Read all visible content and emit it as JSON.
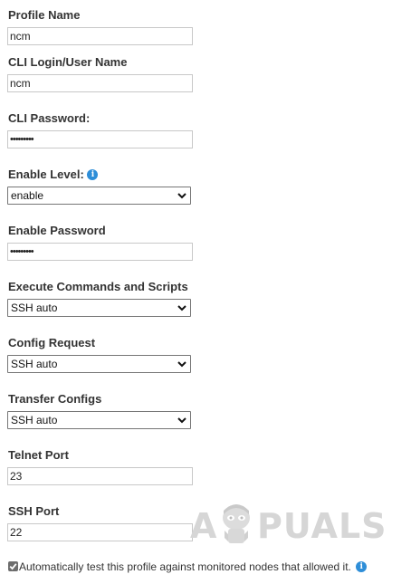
{
  "fields": {
    "profile_name": {
      "label": "Profile Name",
      "value": "ncm"
    },
    "cli_login": {
      "label": "CLI Login/User Name",
      "value": "ncm"
    },
    "cli_password": {
      "label": "CLI Password:",
      "value": "•••••••••"
    },
    "enable_level": {
      "label": "Enable Level:",
      "value": "enable",
      "info_icon": "info-icon"
    },
    "enable_password": {
      "label": "Enable Password",
      "value": "•••••••••"
    },
    "execute_commands": {
      "label": "Execute Commands and Scripts",
      "value": "SSH auto"
    },
    "config_request": {
      "label": "Config Request",
      "value": "SSH auto"
    },
    "transfer_configs": {
      "label": "Transfer Configs",
      "value": "SSH auto"
    },
    "telnet_port": {
      "label": "Telnet Port",
      "value": "23"
    },
    "ssh_port": {
      "label": "SSH Port",
      "value": "22"
    }
  },
  "auto_test": {
    "checked": true,
    "label": "Automatically test this profile against monitored nodes that allowed it.",
    "info_icon": "info-icon"
  },
  "watermark": {
    "text_left": "A",
    "text_right": "PUALS",
    "color": "#d6d6d6"
  },
  "colors": {
    "info_icon": "#2e8ed8",
    "label_text": "#333333",
    "input_border": "#c8c8c8",
    "checkbox": "#6d6d6d"
  }
}
